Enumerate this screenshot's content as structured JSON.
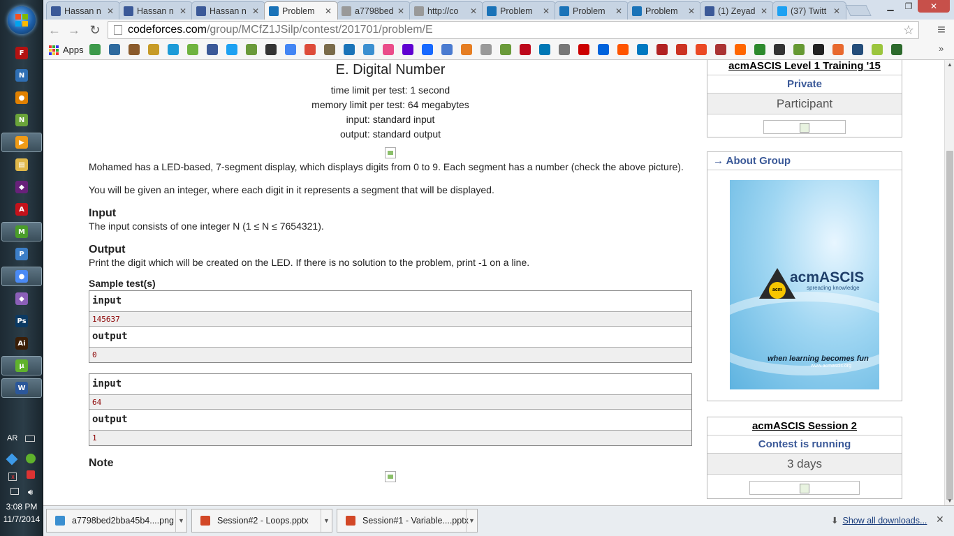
{
  "browser": {
    "tabs": [
      {
        "title": "Hassan n",
        "fav": "facebook-icon",
        "color": "#3b5998"
      },
      {
        "title": "Hassan n",
        "fav": "facebook-icon",
        "color": "#3b5998"
      },
      {
        "title": "Hassan n",
        "fav": "facebook-icon",
        "color": "#3b5998"
      },
      {
        "title": "Problem",
        "fav": "codeforces-icon",
        "color": "#1a73b8",
        "active": true
      },
      {
        "title": "a7798bed",
        "fav": "page-icon",
        "color": "#999999"
      },
      {
        "title": "http://co",
        "fav": "page-icon",
        "color": "#999999"
      },
      {
        "title": "Problem",
        "fav": "codeforces-icon",
        "color": "#1a73b8"
      },
      {
        "title": "Problem",
        "fav": "codeforces-icon",
        "color": "#1a73b8"
      },
      {
        "title": "Problem",
        "fav": "codeforces-icon",
        "color": "#1a73b8"
      },
      {
        "title": "(1) Zeyad",
        "fav": "facebook-icon",
        "color": "#3b5998"
      },
      {
        "title": "(37) Twitt",
        "fav": "twitter-icon",
        "color": "#1da1f2"
      }
    ],
    "url_host": "codeforces.com",
    "url_path": "/group/MCfZ1JSilp/contest/201701/problem/E",
    "apps_label": "Apps"
  },
  "problem": {
    "title": "E. Digital Number",
    "time_limit": "time limit per test: 1 second",
    "memory_limit": "memory limit per test: 64 megabytes",
    "input_file": "input: standard input",
    "output_file": "output: standard output",
    "statement_1": "Mohamed has a LED-based, 7-segment display, which displays digits from 0 to 9. Each segment has a number (check the above picture).",
    "statement_2": "You will be given an integer, where each digit in it represents a segment that will be displayed.",
    "input_heading": "Input",
    "input_spec": "The input consists of one integer N (1  ≤  N  ≤  7654321).",
    "output_heading": "Output",
    "output_spec": "Print the digit which will be created on the LED. If there is no solution to the problem, print -1 on a line.",
    "samples_heading": "Sample test(s)",
    "input_label": "input",
    "output_label": "output",
    "samples": [
      {
        "input": "145637",
        "output": "0"
      },
      {
        "input": "64",
        "output": "1"
      }
    ],
    "note_heading": "Note"
  },
  "sidebar": {
    "contest_box": {
      "title": "acmASCIS Level 1 Training '15",
      "visibility": "Private",
      "role": "Participant"
    },
    "about_group": {
      "heading": "→ About Group",
      "poster_tagline": "when learning becomes fun",
      "poster_brand": "acmASCIS",
      "poster_sub": "spreading knowledge",
      "poster_web": "www.acmascis.org"
    },
    "session_box": {
      "title": "acmASCIS Session 2",
      "status": "Contest is running",
      "remaining": "3 days"
    }
  },
  "downloads": {
    "items": [
      {
        "name": "a7798bed2bba45b4....png",
        "icon": "image-file-icon",
        "color": "#3b8fd0"
      },
      {
        "name": "Session#2 - Loops.pptx",
        "icon": "powerpoint-icon",
        "color": "#d24726"
      },
      {
        "name": "Session#1 - Variable....pptx",
        "icon": "powerpoint-icon",
        "color": "#d24726"
      }
    ],
    "show_all": "Show all downloads..."
  },
  "taskbar": {
    "apps": [
      {
        "name": "filezilla-icon",
        "color": "#b31212",
        "glyph": "F"
      },
      {
        "name": "network-icon",
        "color": "#2f6fb4",
        "glyph": "N"
      },
      {
        "name": "vlc-icon",
        "color": "#e08000",
        "glyph": "●"
      },
      {
        "name": "notepadpp-icon",
        "color": "#6aa43a",
        "glyph": "N"
      },
      {
        "name": "media-player-icon",
        "color": "#f09b16",
        "glyph": "▶"
      },
      {
        "name": "explorer-icon",
        "color": "#e0b84a",
        "glyph": "▤"
      },
      {
        "name": "visual-studio-icon",
        "color": "#68217a",
        "glyph": "◆"
      },
      {
        "name": "acrobat-icon",
        "color": "#c4121b",
        "glyph": "A"
      },
      {
        "name": "messenger-icon",
        "color": "#4a9d2a",
        "glyph": "M"
      },
      {
        "name": "paint-icon",
        "color": "#3c7ec7",
        "glyph": "P"
      },
      {
        "name": "chrome-icon",
        "color": "#4a8af4",
        "glyph": "●"
      },
      {
        "name": "vs-express-icon",
        "color": "#8b5fb8",
        "glyph": "◆"
      },
      {
        "name": "photoshop-icon",
        "color": "#0b3a63",
        "glyph": "Ps"
      },
      {
        "name": "illustrator-icon",
        "color": "#3a1e07",
        "glyph": "Ai"
      },
      {
        "name": "utorrent-icon",
        "color": "#5fb22c",
        "glyph": "µ"
      },
      {
        "name": "word-icon",
        "color": "#2b579a",
        "glyph": "W"
      }
    ],
    "lang": "AR",
    "time": "3:08 PM",
    "date": "11/7/2014"
  }
}
